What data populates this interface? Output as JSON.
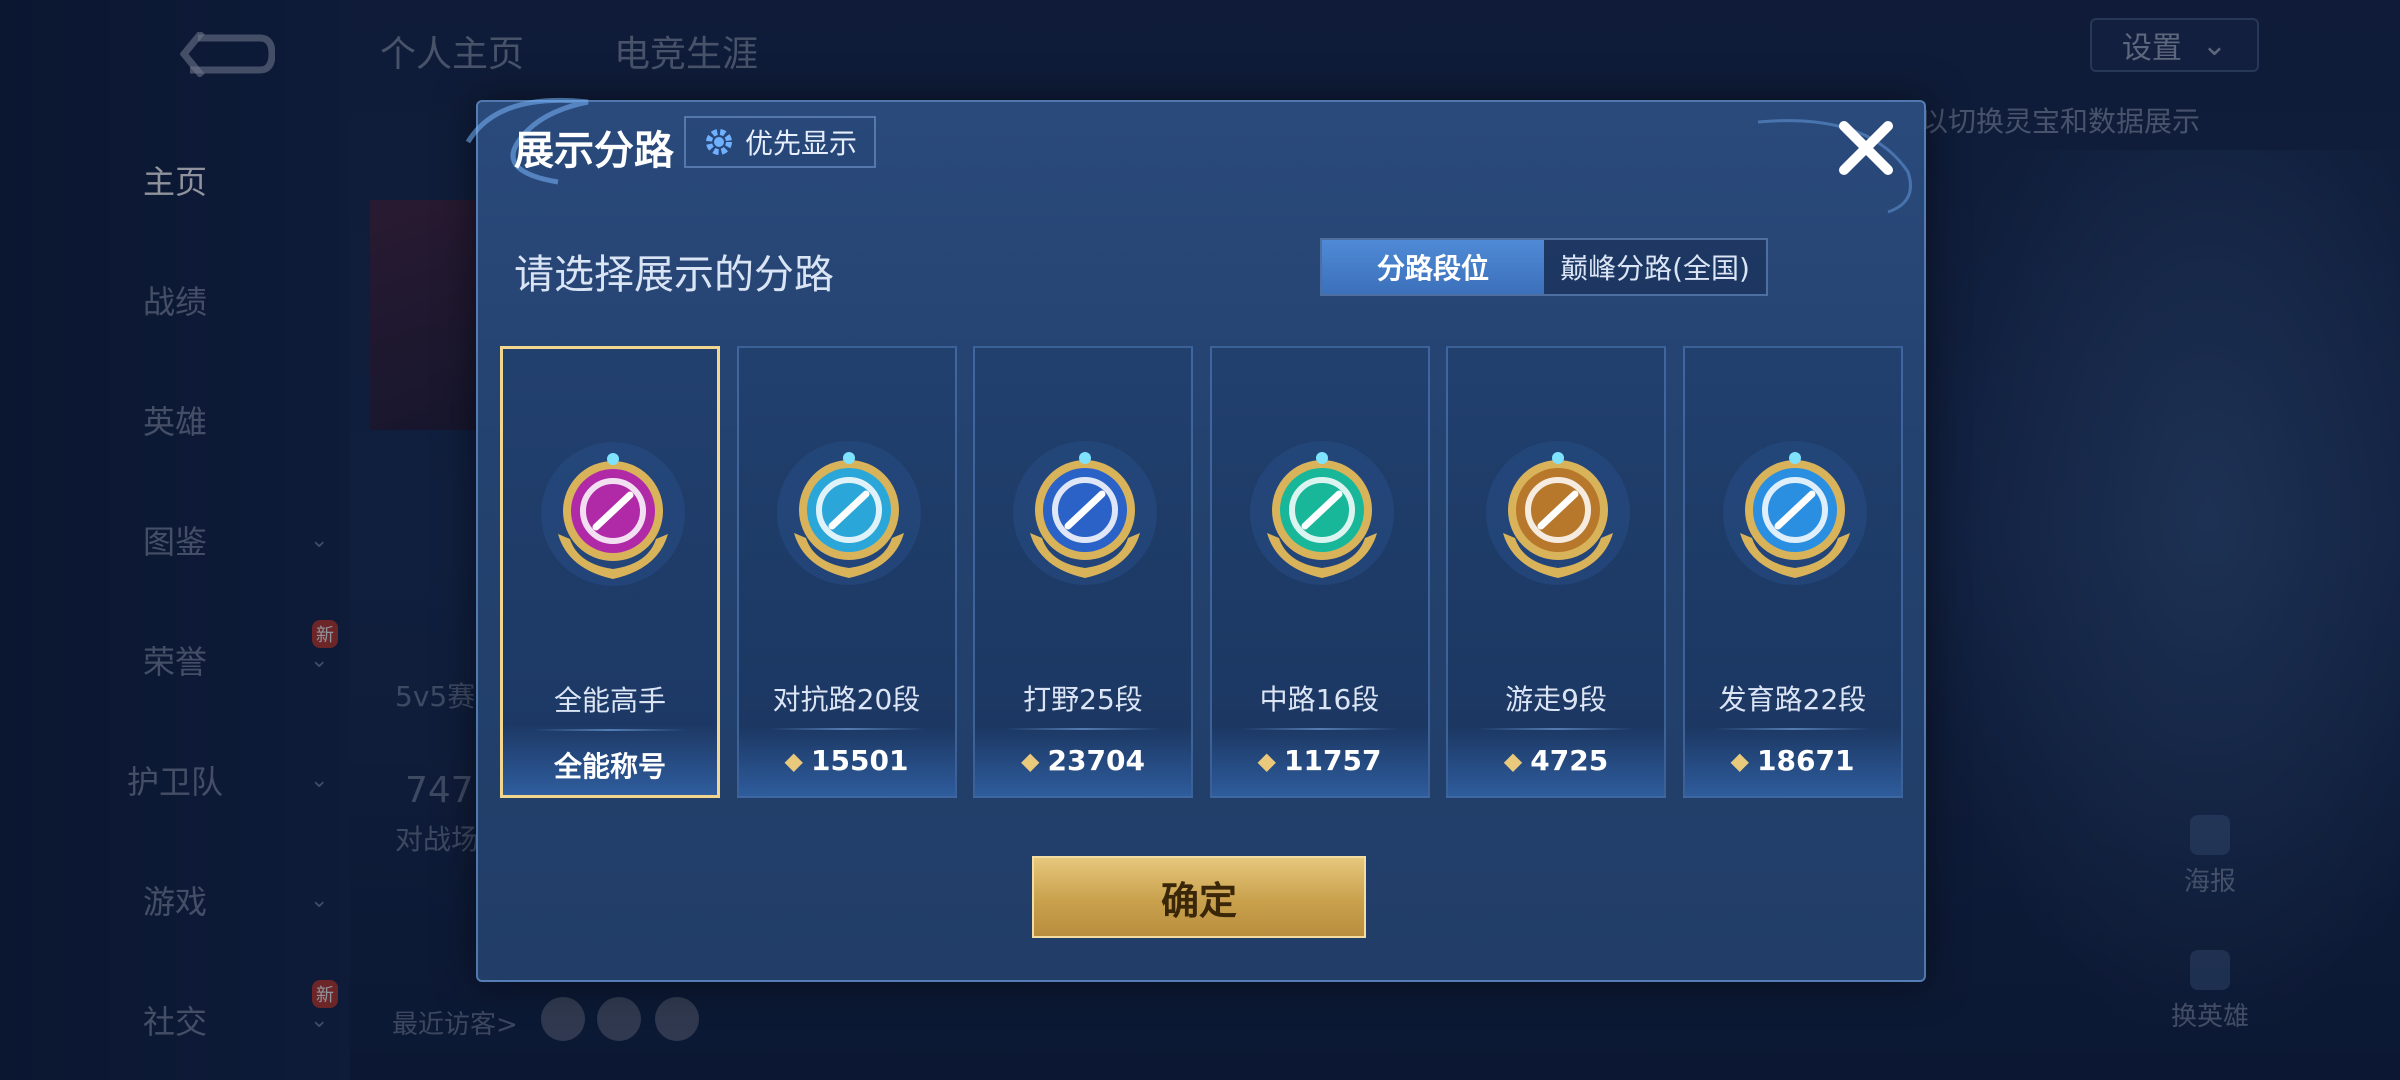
{
  "background": {
    "top_tabs": [
      "个人主页",
      "电竞生涯"
    ],
    "settings_label": "设置",
    "side_hint": "以切换灵宝和数据展示",
    "nav_items": [
      {
        "label": "主页",
        "active": true,
        "chevron": false,
        "new": false
      },
      {
        "label": "战绩",
        "active": false,
        "chevron": false,
        "new": false
      },
      {
        "label": "英雄",
        "active": false,
        "chevron": false,
        "new": false
      },
      {
        "label": "图鉴",
        "active": false,
        "chevron": true,
        "new": false
      },
      {
        "label": "荣誉",
        "active": false,
        "chevron": true,
        "new": true
      },
      {
        "label": "护卫队",
        "active": false,
        "chevron": true,
        "new": false
      },
      {
        "label": "游戏",
        "active": false,
        "chevron": true,
        "new": false
      },
      {
        "label": "社交",
        "active": false,
        "chevron": true,
        "new": true
      }
    ],
    "new_badge": "新",
    "mode_text": "5v5赛",
    "count_text": "747",
    "count_sub": "对战场",
    "visitors_label": "最近访客>",
    "right_tools": [
      "海报",
      "换英雄"
    ]
  },
  "modal": {
    "title": "展示分路",
    "priority_button": "优先显示",
    "subtitle": "请选择展示的分路",
    "tabs": [
      {
        "label": "分路段位",
        "active": true
      },
      {
        "label": "巅峰分路(全国)",
        "active": false
      }
    ],
    "cards": [
      {
        "name": "全能高手",
        "score": "全能称号",
        "show_diamond": false,
        "selected": true,
        "medal_color": "#b02aa8",
        "medal_icon": "allround-icon"
      },
      {
        "name": "对抗路20段",
        "score": "15501",
        "show_diamond": true,
        "selected": false,
        "medal_color": "#2aa7d8",
        "medal_icon": "sword-shield-icon"
      },
      {
        "name": "打野25段",
        "score": "23704",
        "show_diamond": true,
        "selected": false,
        "medal_color": "#2a62c8",
        "medal_icon": "dragon-icon"
      },
      {
        "name": "中路16段",
        "score": "11757",
        "show_diamond": true,
        "selected": false,
        "medal_color": "#18b79a",
        "medal_icon": "mid-lane-icon"
      },
      {
        "name": "游走9段",
        "score": "4725",
        "show_diamond": true,
        "selected": false,
        "medal_color": "#b8782c",
        "medal_icon": "wings-icon"
      },
      {
        "name": "发育路22段",
        "score": "18671",
        "show_diamond": true,
        "selected": false,
        "medal_color": "#2a8fe0",
        "medal_icon": "target-icon"
      }
    ],
    "confirm_button": "确定"
  },
  "colors": {
    "accent_gold": "#f3d68e",
    "tab_active": "#4f8ad6",
    "score_diamond": "#e9c97c"
  }
}
